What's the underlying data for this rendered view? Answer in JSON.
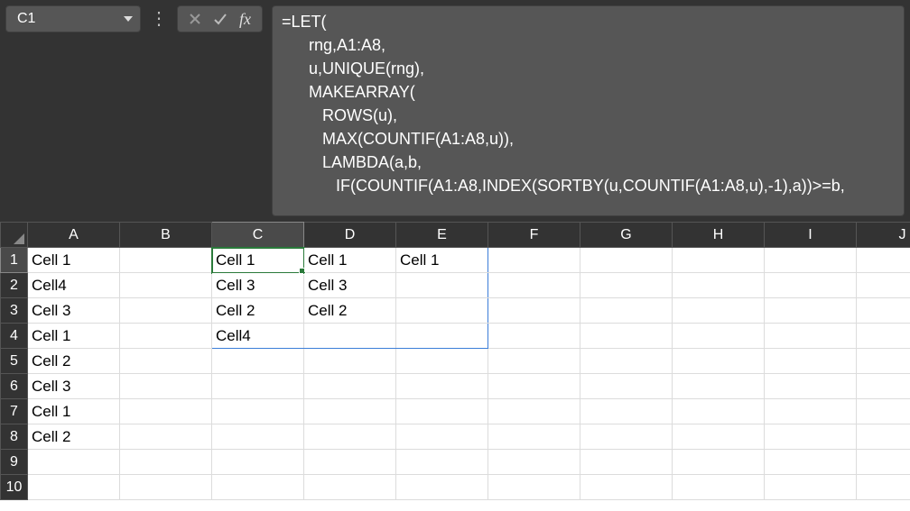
{
  "nameBox": {
    "value": "C1"
  },
  "formula": {
    "lines": [
      "=LET(",
      "      rng,A1:A8,",
      "      u,UNIQUE(rng),",
      "      MAKEARRAY(",
      "         ROWS(u),",
      "         MAX(COUNTIF(A1:A8,u)),",
      "         LAMBDA(a,b,",
      "            IF(COUNTIF(A1:A8,INDEX(SORTBY(u,COUNTIF(A1:A8,u),-1),a))>=b,"
    ],
    "fxLabel": "fx"
  },
  "grid": {
    "columns": [
      "A",
      "B",
      "C",
      "D",
      "E",
      "F",
      "G",
      "H",
      "I",
      "J"
    ],
    "rows": [
      "1",
      "2",
      "3",
      "4",
      "5",
      "6",
      "7",
      "8",
      "9",
      "10"
    ],
    "activeCell": "C1",
    "spillRange": {
      "startCol": 2,
      "endCol": 4,
      "startRow": 0,
      "endRow": 3
    },
    "cells": {
      "A1": "Cell 1",
      "A2": "Cell4",
      "A3": "Cell 3",
      "A4": "Cell 1",
      "A5": "Cell 2",
      "A6": "Cell 3",
      "A7": "Cell 1",
      "A8": "Cell 2",
      "C1": "Cell 1",
      "C2": "Cell 3",
      "C3": "Cell 2",
      "C4": "Cell4",
      "D1": "Cell 1",
      "D2": "Cell 3",
      "D3": "Cell 2",
      "E1": "Cell 1"
    }
  }
}
